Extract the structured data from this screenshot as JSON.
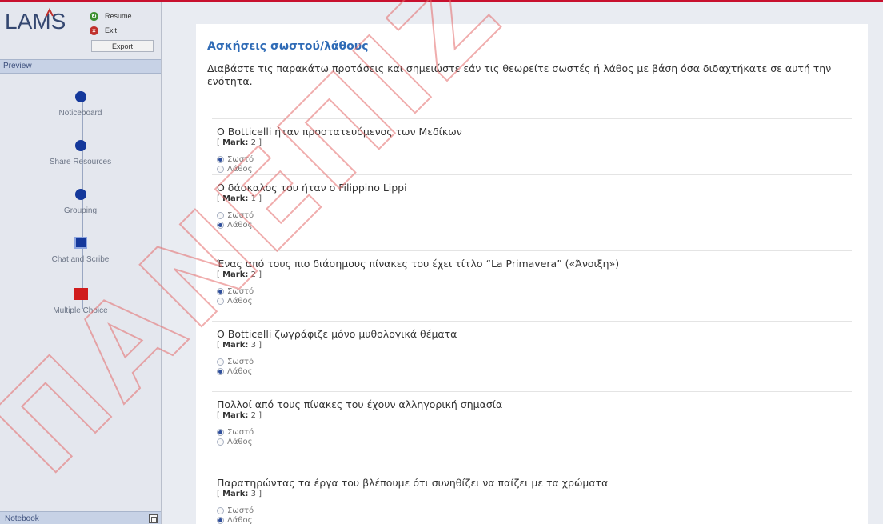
{
  "app": {
    "brand": "LAMS",
    "controls": {
      "resume": "Resume",
      "exit": "Exit",
      "export": "Export"
    }
  },
  "sidebar": {
    "preview_label": "Preview",
    "activities": [
      {
        "label": "Noticeboard",
        "shape": "circle"
      },
      {
        "label": "Share Resources",
        "shape": "circle"
      },
      {
        "label": "Grouping",
        "shape": "circle"
      },
      {
        "label": "Chat and Scribe",
        "shape": "square"
      },
      {
        "label": "Multiple Choice",
        "shape": "red-square"
      }
    ],
    "notebook_label": "Notebook"
  },
  "content": {
    "title": "Ασκήσεις σωστού/λάθους",
    "intro": "Διαβάστε τις παρακάτω προτάσεις και σημειώστε εάν τις θεωρείτε σωστές ή λάθος με βάση όσα διδαχτήκατε σε αυτή την ενότητα.",
    "mark_label": "Mark:",
    "option_true": "Σωστό",
    "option_false": "Λάθος",
    "questions": [
      {
        "text": "Ο Botticelli ήταν προστατευόμενος των Μεδίκων",
        "mark": "2",
        "selected": "true"
      },
      {
        "text": "Ο δάσκαλος του ήταν ο Filippino Lippi",
        "mark": "1",
        "selected": "false"
      },
      {
        "text": "Ένας από τους πιο διάσημους πίνακες του έχει τίτλο “La Primavera” («Άνοιξη»)",
        "mark": "2",
        "selected": "true"
      },
      {
        "text": "Ο Botticelli ζωγράφιζε μόνο μυθολογικά θέματα",
        "mark": "3",
        "selected": "false"
      },
      {
        "text": "Πολλοί από τους πίνακες του έχουν αλληγορική σημασία",
        "mark": "2",
        "selected": "true"
      },
      {
        "text": "Παρατηρώντας τα έργα του βλέπουμε ότι συνηθίζει να παίζει με τα χρώματα",
        "mark": "3",
        "selected": "false"
      }
    ]
  },
  "watermark": {
    "text": "ΠΑΝΕΠΙΖ"
  },
  "colors": {
    "accent": "#2f6bb6",
    "node": "#14389b",
    "active_node": "#d01c1c",
    "rule": "#c8102e"
  }
}
